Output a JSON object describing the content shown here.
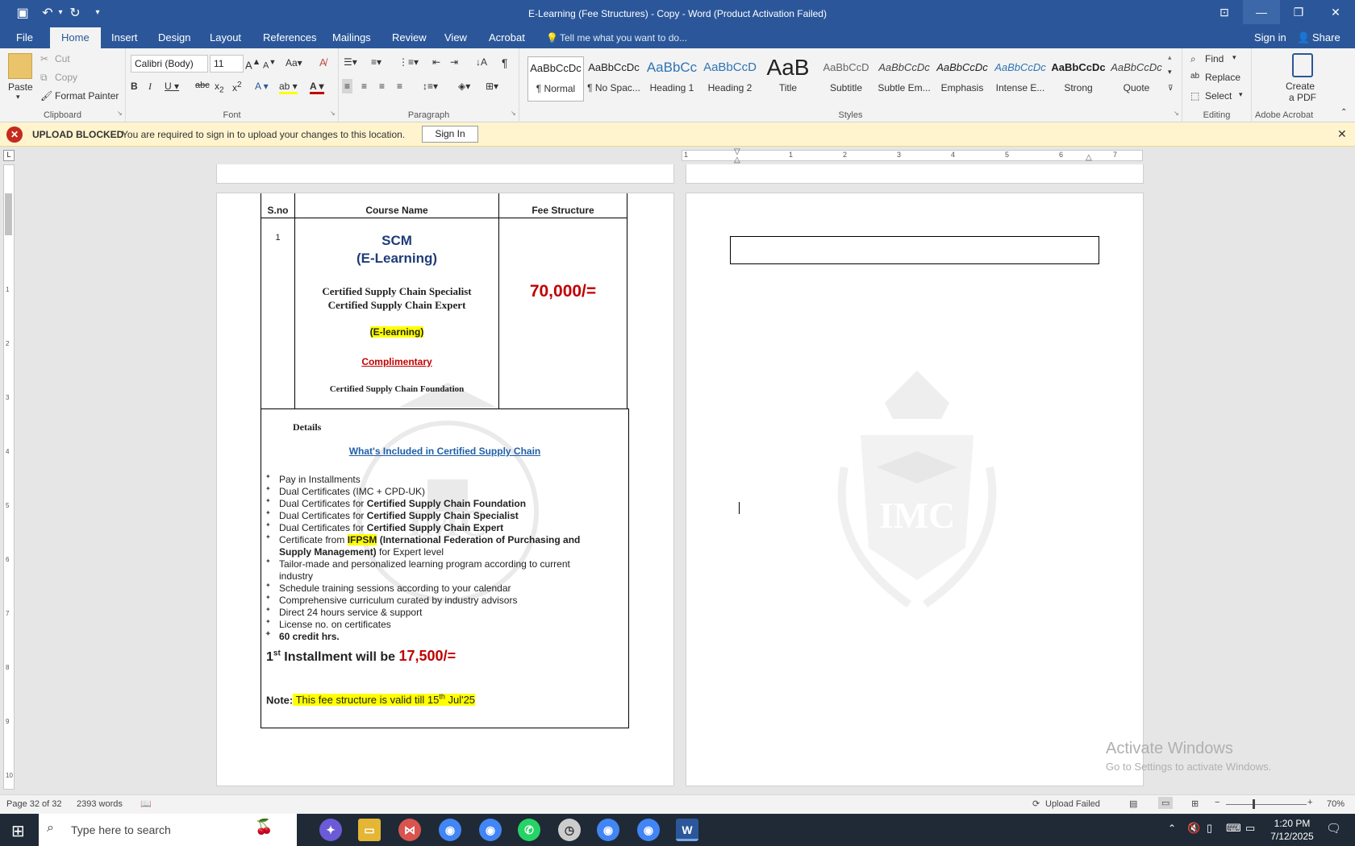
{
  "window": {
    "title": "E-Learning (Fee Structures) - Copy - Word (Product Activation Failed)",
    "quick_access": [
      "save-icon",
      "undo-icon",
      "redo-icon",
      "customize-icon"
    ]
  },
  "tabs": [
    "File",
    "Home",
    "Insert",
    "Design",
    "Layout",
    "References",
    "Mailings",
    "Review",
    "View",
    "Acrobat"
  ],
  "tell_me": "Tell me what you want to do...",
  "account": {
    "sign_in": "Sign in",
    "share": "Share"
  },
  "ribbon": {
    "clipboard": {
      "label": "Clipboard",
      "paste": "Paste",
      "cut": "Cut",
      "copy": "Copy",
      "format_painter": "Format Painter"
    },
    "font": {
      "label": "Font",
      "name": "Calibri (Body)",
      "size": "11"
    },
    "paragraph": {
      "label": "Paragraph"
    },
    "styles": {
      "label": "Styles",
      "items": [
        {
          "preview": "AaBbCcDc",
          "name": "¶ Normal"
        },
        {
          "preview": "AaBbCcDc",
          "name": "¶ No Spac..."
        },
        {
          "preview": "AaBbCc",
          "name": "Heading 1"
        },
        {
          "preview": "AaBbCcD",
          "name": "Heading 2"
        },
        {
          "preview": "AaB",
          "name": "Title"
        },
        {
          "preview": "AaBbCcD",
          "name": "Subtitle"
        },
        {
          "preview": "AaBbCcDc",
          "name": "Subtle Em..."
        },
        {
          "preview": "AaBbCcDc",
          "name": "Emphasis"
        },
        {
          "preview": "AaBbCcDc",
          "name": "Intense E..."
        },
        {
          "preview": "AaBbCcDc",
          "name": "Strong"
        },
        {
          "preview": "AaBbCcDc",
          "name": "Quote"
        }
      ]
    },
    "editing": {
      "label": "Editing",
      "find": "Find",
      "replace": "Replace",
      "select": "Select"
    },
    "acrobat": {
      "label": "Adobe Acrobat",
      "create_pdf": "Create",
      "create_pdf2": "a PDF"
    }
  },
  "message_bar": {
    "title": "UPLOAD BLOCKED",
    "text": "You are required to sign in to upload your changes to this location.",
    "button": "Sign In"
  },
  "ruler": [
    "1",
    "1",
    "2",
    "3",
    "4",
    "5",
    "6",
    "7"
  ],
  "vruler": [
    "1",
    "2",
    "3",
    "4",
    "5",
    "6",
    "7",
    "8",
    "9",
    "10"
  ],
  "doc": {
    "headers": {
      "sno": "S.no",
      "course": "Course Name",
      "fee": "Fee Structure"
    },
    "row_no": "1",
    "course_title1": "SCM",
    "course_title2": "(E-Learning)",
    "cert1": "Certified Supply Chain Specialist",
    "cert2": "Certified Supply Chain Expert",
    "mode": "(E-learning)",
    "complimentary": "Complimentary",
    "foundation": "Certified Supply Chain Foundation",
    "fee": "70,000/=",
    "details": "Details",
    "included_link": "What's Included in Certified Supply Chain",
    "bullets": [
      {
        "plain": "Pay in Installments",
        "bold": ""
      },
      {
        "plain": "Dual Certificates (IMC + CPD-UK)",
        "bold": ""
      },
      {
        "plain": "Dual Certificates for ",
        "bold": "Certified Supply Chain Foundation"
      },
      {
        "plain": "Dual Certificates for ",
        "bold": "Certified Supply Chain Specialist"
      },
      {
        "plain": "Dual Certificates for ",
        "bold": "Certified Supply Chain Expert"
      }
    ],
    "ifpsm": {
      "pre": "Certificate from ",
      "hl": "IFPSM",
      "bold1": " (International Federation of Purchasing and",
      "bold2": "Supply Management)",
      "post": " for Expert level"
    },
    "tailor1": "Tailor-made and personalized learning program according to current",
    "tailor2": "industry",
    "bullets2": [
      "Schedule training sessions according to your calendar",
      "Comprehensive curriculum curated by industry advisors",
      "Direct 24 hours service & support",
      "License no. on certificates"
    ],
    "credit": "60 credit hrs.",
    "installment_pre": "1",
    "installment_sup": "st",
    "installment_text": " Installment will be ",
    "installment_amount": "17,500/=",
    "note_label": "Note:",
    "note_pre": " This fee structure is valid till 15",
    "note_sup": "th",
    "note_post": " Jul'25",
    "watermark": "IMC"
  },
  "activate": {
    "title": "Activate Windows",
    "sub": "Go to Settings to activate Windows."
  },
  "status": {
    "page": "Page 32 of 32",
    "words": "2393 words",
    "upload": "Upload Failed",
    "zoom": "70%"
  },
  "taskbar": {
    "search": "Type here to search",
    "time": "1:20 PM",
    "date": "7/12/2025"
  },
  "colors": {
    "word_blue": "#2b579a",
    "fee_red": "#c00000",
    "highlight": "#ffff00",
    "link_blue": "#1f5fa8"
  }
}
